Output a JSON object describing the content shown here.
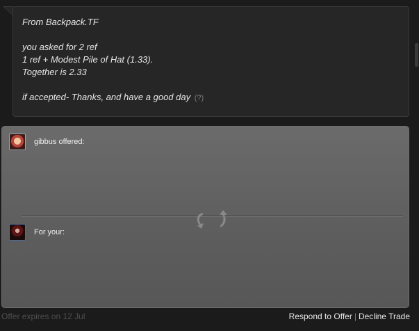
{
  "message": {
    "lines": [
      "From Backpack.TF",
      "",
      "you asked for 2 ref",
      "1 ref + Modest Pile of Hat (1.33).",
      "Together is 2.33",
      "",
      "if accepted- Thanks, and have a good day"
    ],
    "help_link": "(?)"
  },
  "trade": {
    "them_label": "gibbus offered:",
    "you_label": "For your:",
    "swap_icon": "swap-arrows-icon"
  },
  "footer": {
    "expires": "Offer expires on 12 Jul",
    "respond_label": "Respond to Offer",
    "separator": "|",
    "decline_label": "Decline Trade"
  },
  "colors": {
    "background": "#1b1b1b",
    "bubble": "#262626",
    "panel": "#5d5d5d",
    "text": "#e6e6e6",
    "muted": "#4e4e4e"
  }
}
